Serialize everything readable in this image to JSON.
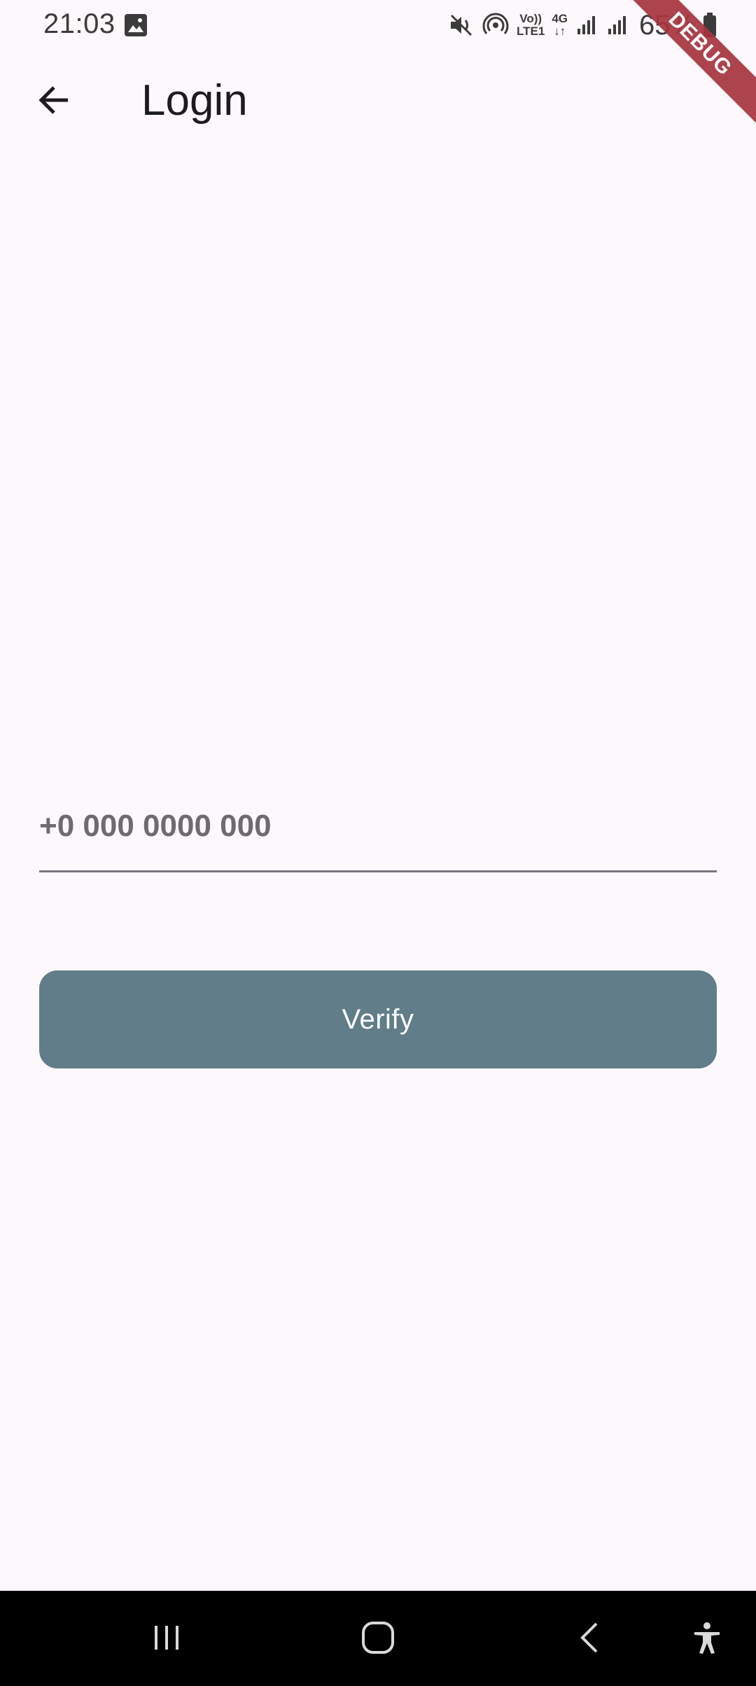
{
  "status_bar": {
    "time": "21:03",
    "battery_percent": "65%",
    "icons": [
      "gallery-icon",
      "mute-icon",
      "hotspot-icon",
      "volte-icon",
      "4g-data-icon",
      "signal-icon",
      "signal-icon",
      "battery-icon"
    ],
    "volte_label_top": "Vo))",
    "volte_label_bottom": "LTE1",
    "network_label": "4G"
  },
  "debug_banner": "DEBUG",
  "app_bar": {
    "title": "Login",
    "back_icon": "arrow-back-icon"
  },
  "phone_input": {
    "value": "",
    "placeholder": "+0 000 0000 000"
  },
  "verify_button": {
    "label": "Verify"
  },
  "colors": {
    "background": "#fdf8fc",
    "button": "#617d89",
    "debug_ribbon": "#a7343f",
    "nav_bar": "#000000"
  },
  "nav_bar": {
    "items": [
      "recents-icon",
      "home-icon",
      "back-icon",
      "accessibility-icon"
    ]
  }
}
